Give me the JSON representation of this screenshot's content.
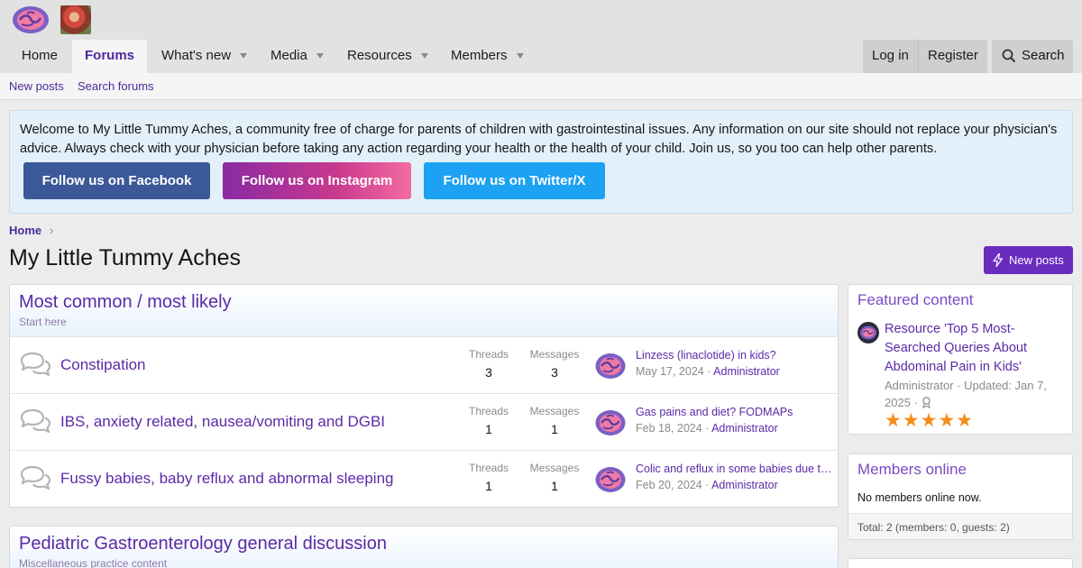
{
  "nav": {
    "items": [
      {
        "label": "Home"
      },
      {
        "label": "Forums"
      },
      {
        "label": "What's new"
      },
      {
        "label": "Media"
      },
      {
        "label": "Resources"
      },
      {
        "label": "Members"
      }
    ],
    "login_label": "Log in",
    "register_label": "Register",
    "search_label": "Search"
  },
  "subnav": {
    "new_posts": "New posts",
    "search_forums": "Search forums"
  },
  "notice": {
    "text": "Welcome to My Little Tummy Aches, a community free of charge for parents of children with gastrointestinal issues. Any information on our site should not replace your physician's advice. Always check with your physician before taking any action regarding your health or the health of your child. Join us, so you too can help other parents.",
    "buttons": [
      "Follow us on Facebook",
      "Follow us on Instagram",
      "Follow us on Twitter/X"
    ],
    "colors": {
      "facebook": "#3b5998",
      "instagram_start": "#8a2aa2",
      "instagram_end": "#f46ba0",
      "twitter": "#1da1f2"
    }
  },
  "breadcrumb": {
    "home": "Home",
    "separator": "›"
  },
  "page_title": "My Little Tummy Aches",
  "new_posts_button": "New posts",
  "categories": [
    {
      "title": "Most common / most likely",
      "description": "Start here",
      "forums": [
        {
          "title": "Constipation",
          "threads_label": "Threads",
          "threads": "3",
          "messages_label": "Messages",
          "messages": "3",
          "last_title": "Linzess (linaclotide) in kids?",
          "last_date": "May 17, 2024",
          "last_sep": " · ",
          "last_user": "Administrator"
        },
        {
          "title": "IBS, anxiety related, nausea/vomiting and DGBI",
          "threads_label": "Threads",
          "threads": "1",
          "messages_label": "Messages",
          "messages": "1",
          "last_title": "Gas pains and diet? FODMAPs",
          "last_date": "Feb 18, 2024",
          "last_sep": " · ",
          "last_user": "Administrator"
        },
        {
          "title": "Fussy babies, baby reflux and abnormal sleeping",
          "threads_label": "Threads",
          "threads": "1",
          "messages_label": "Messages",
          "messages": "1",
          "last_title": "Colic and reflux in some babies due to food allergies",
          "last_date": "Feb 20, 2024",
          "last_sep": " · ",
          "last_user": "Administrator"
        }
      ]
    },
    {
      "title": "Pediatric Gastroenterology general discussion",
      "description": "Miscellaneous practice content",
      "forums": []
    }
  ],
  "sidebar": {
    "featured": {
      "heading": "Featured content",
      "title": "Resource 'Top 5 Most-Searched Queries About Abdominal Pain in Kids'",
      "meta": "Administrator · Updated: Jan 7, 2025 ·",
      "rating": 5,
      "stars": "★★★★★"
    },
    "members_online": {
      "heading": "Members online",
      "text": "No members online now.",
      "total": "Total: 2 (members: 0, guests: 2)"
    }
  },
  "icons": {
    "logo": "brain-logo-icon",
    "forum": "forum-chat-icon",
    "search": "search-icon",
    "bolt": "bolt-icon",
    "award": "award-icon"
  },
  "colors": {
    "accent": "#5b2aa6",
    "button": "#6a2bbf",
    "star": "#f28d1a"
  }
}
